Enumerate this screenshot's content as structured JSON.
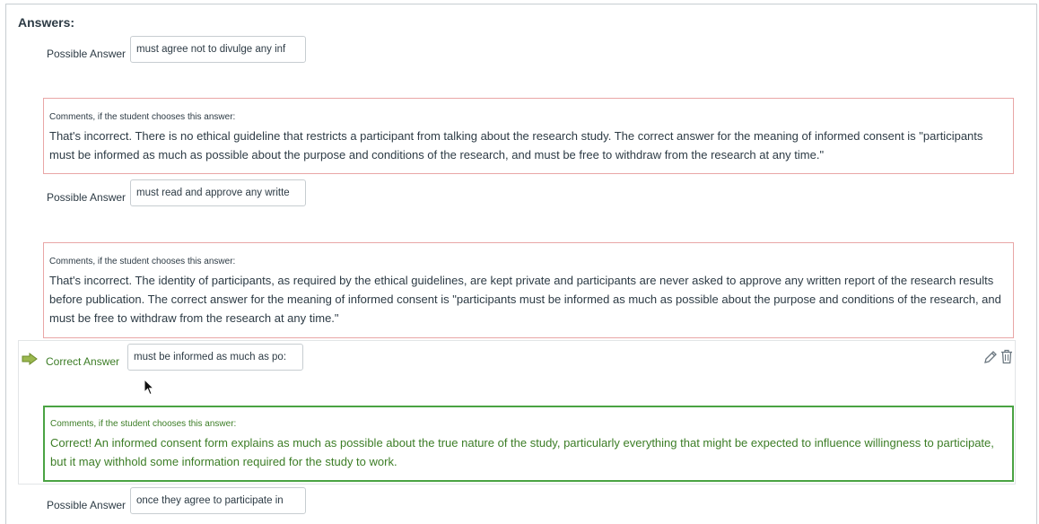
{
  "section_title": "Answers:",
  "possible_answer_label": "Possible Answer",
  "correct_answer_label": "Correct Answer",
  "comments_label": "Comments, if the student chooses this answer:",
  "answers": [
    {
      "value": "must agree not to divulge any inf",
      "comment": "That's incorrect. There is no ethical guideline that restricts a participant from talking about the research study. The correct answer for the meaning of informed consent is \"participants must be informed as much as possible about the purpose and conditions of the research, and must be free to withdraw from the research at any time.\""
    },
    {
      "value": "must read and approve any writte",
      "comment": "That's incorrect. The identity of participants, as required by the ethical guidelines, are kept private and participants are never asked to approve any written report of the research results before publication. The correct answer for the meaning of informed consent is \"participants must be informed as much as possible about the purpose and conditions of the research, and must be free to withdraw from the research at any time.\""
    },
    {
      "value": "must be informed as much as po:",
      "correct": true,
      "comment": "Correct! An informed consent form explains as much as possible about the true nature of the study, particularly everything that might be expected to influence willingness to participate, but it may withhold some information required for the study to work."
    },
    {
      "value": "once they agree to participate in"
    }
  ],
  "icons": {
    "correct_marker": "arrow-right-icon",
    "edit": "pencil-icon",
    "delete": "trash-icon"
  },
  "colors": {
    "wrong_border": "#e9a6a6",
    "correct_border": "#4aa343",
    "correct_text": "#3c7d26"
  }
}
